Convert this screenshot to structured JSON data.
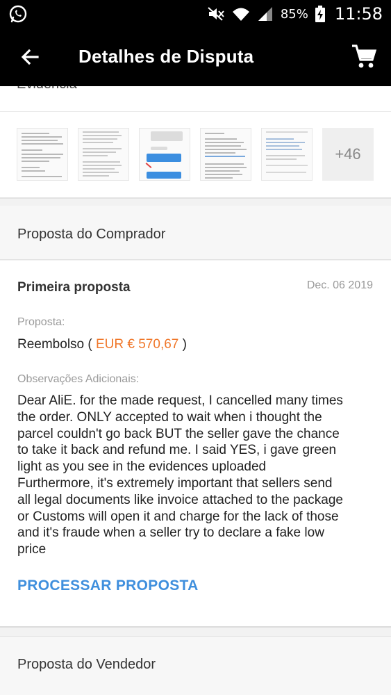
{
  "status_bar": {
    "app_icon": "whatsapp-icon",
    "battery_percent": "85%",
    "time": "11:58"
  },
  "app_bar": {
    "title": "Detalhes de Disputa",
    "back_icon": "arrow-left-icon",
    "cart_icon": "shopping-cart-icon"
  },
  "evidence": {
    "title": "Evidência",
    "more_count": "+46"
  },
  "buyer_section": {
    "header": "Proposta do Comprador"
  },
  "proposal": {
    "title": "Primeira proposta",
    "date": "Dec. 06 2019",
    "proposal_label": "Proposta:",
    "refund_prefix": "Reembolso (",
    "refund_amount": "EUR € 570,67",
    "refund_suffix": ")",
    "notes_label": "Observações Adicionais:",
    "notes_lines": [
      "Dear AliE. for the made request, I cancelled many times",
      "the order. ONLY accepted to wait when i thought the",
      "parcel couldn't go back BUT the seller gave the chance",
      "to take it back and refund me. I said YES, i gave green",
      "light as you see in the evidences uploaded",
      "Furthermore, it's extremely important that sellers send",
      "all legal documents like invoice attached to the package",
      "or Customs will open it and charge for the lack of those",
      "and it's fraude when a seller try to declare a fake low",
      "price"
    ],
    "action_label": "PROCESSAR PROPOSTA"
  },
  "seller_section": {
    "header": "Proposta do Vendedor"
  },
  "colors": {
    "accent_blue": "#3f8fdd",
    "amount_orange": "#f0772a",
    "bar_black": "#000000"
  }
}
